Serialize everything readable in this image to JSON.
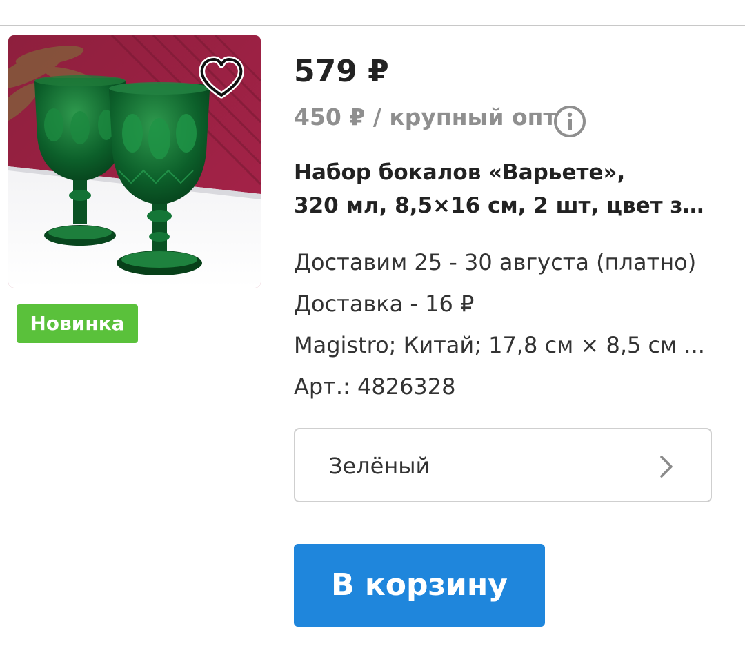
{
  "product": {
    "price": "579 ₽",
    "wholesale_price": "450 ₽ / крупный опт",
    "badge": "Новинка",
    "title_line1": "Набор бокалов «Варьете»,",
    "title_line2": "320 мл, 8,5×16 см, 2 шт, цвет зе...",
    "delivery_dates": "Доставим 25 - 30 августа (платно)",
    "delivery_cost": "Доставка - 16 ₽",
    "specs": "Magistro; Китай; 17,8 см × 8,5 см ...",
    "sku": "Арт.: 4826328"
  },
  "variant": {
    "selected": "Зелёный"
  },
  "actions": {
    "add_to_cart": "В корзину"
  },
  "icons": {
    "favorite": "heart-icon",
    "info": "info-icon",
    "variant_chevron": "chevron-right-icon"
  },
  "colors": {
    "badge_green": "#5ac13b",
    "cart_button_blue": "#1f86dc",
    "muted_text": "#8f8f8f"
  }
}
